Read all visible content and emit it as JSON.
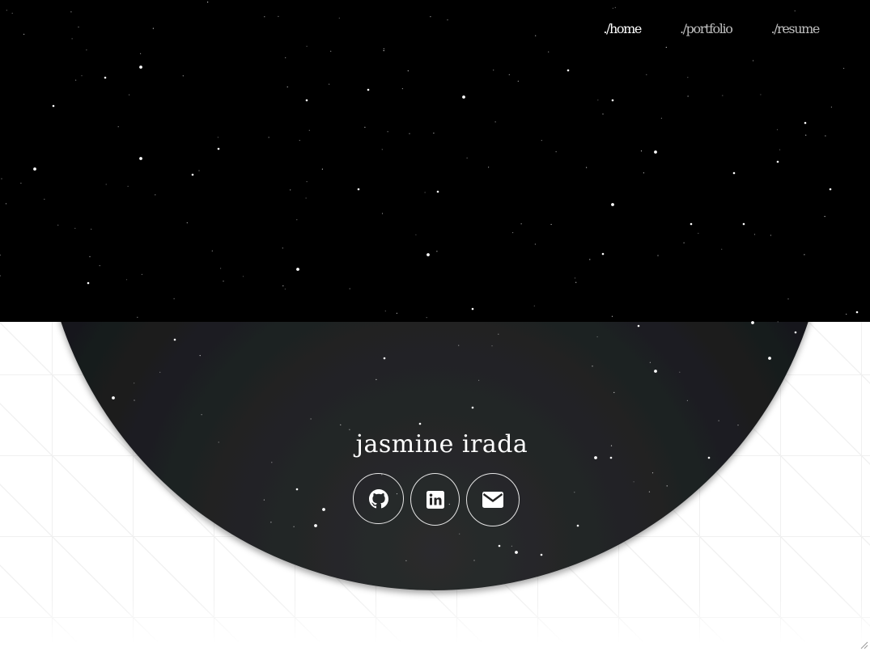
{
  "nav": {
    "items": [
      {
        "label": "./home",
        "active": true
      },
      {
        "label": "./portfolio",
        "active": false
      },
      {
        "label": "./resume",
        "active": false
      }
    ]
  },
  "hero": {
    "name": "jasmine irada",
    "social": [
      {
        "icon": "github-icon"
      },
      {
        "icon": "linkedin-icon"
      },
      {
        "icon": "email-icon"
      }
    ]
  },
  "colors": {
    "sky": "#000000",
    "circle_top": "#151719",
    "circle_bottom": "#2a2c2d",
    "grid_line": "#ececec",
    "text": "#ffffff"
  }
}
